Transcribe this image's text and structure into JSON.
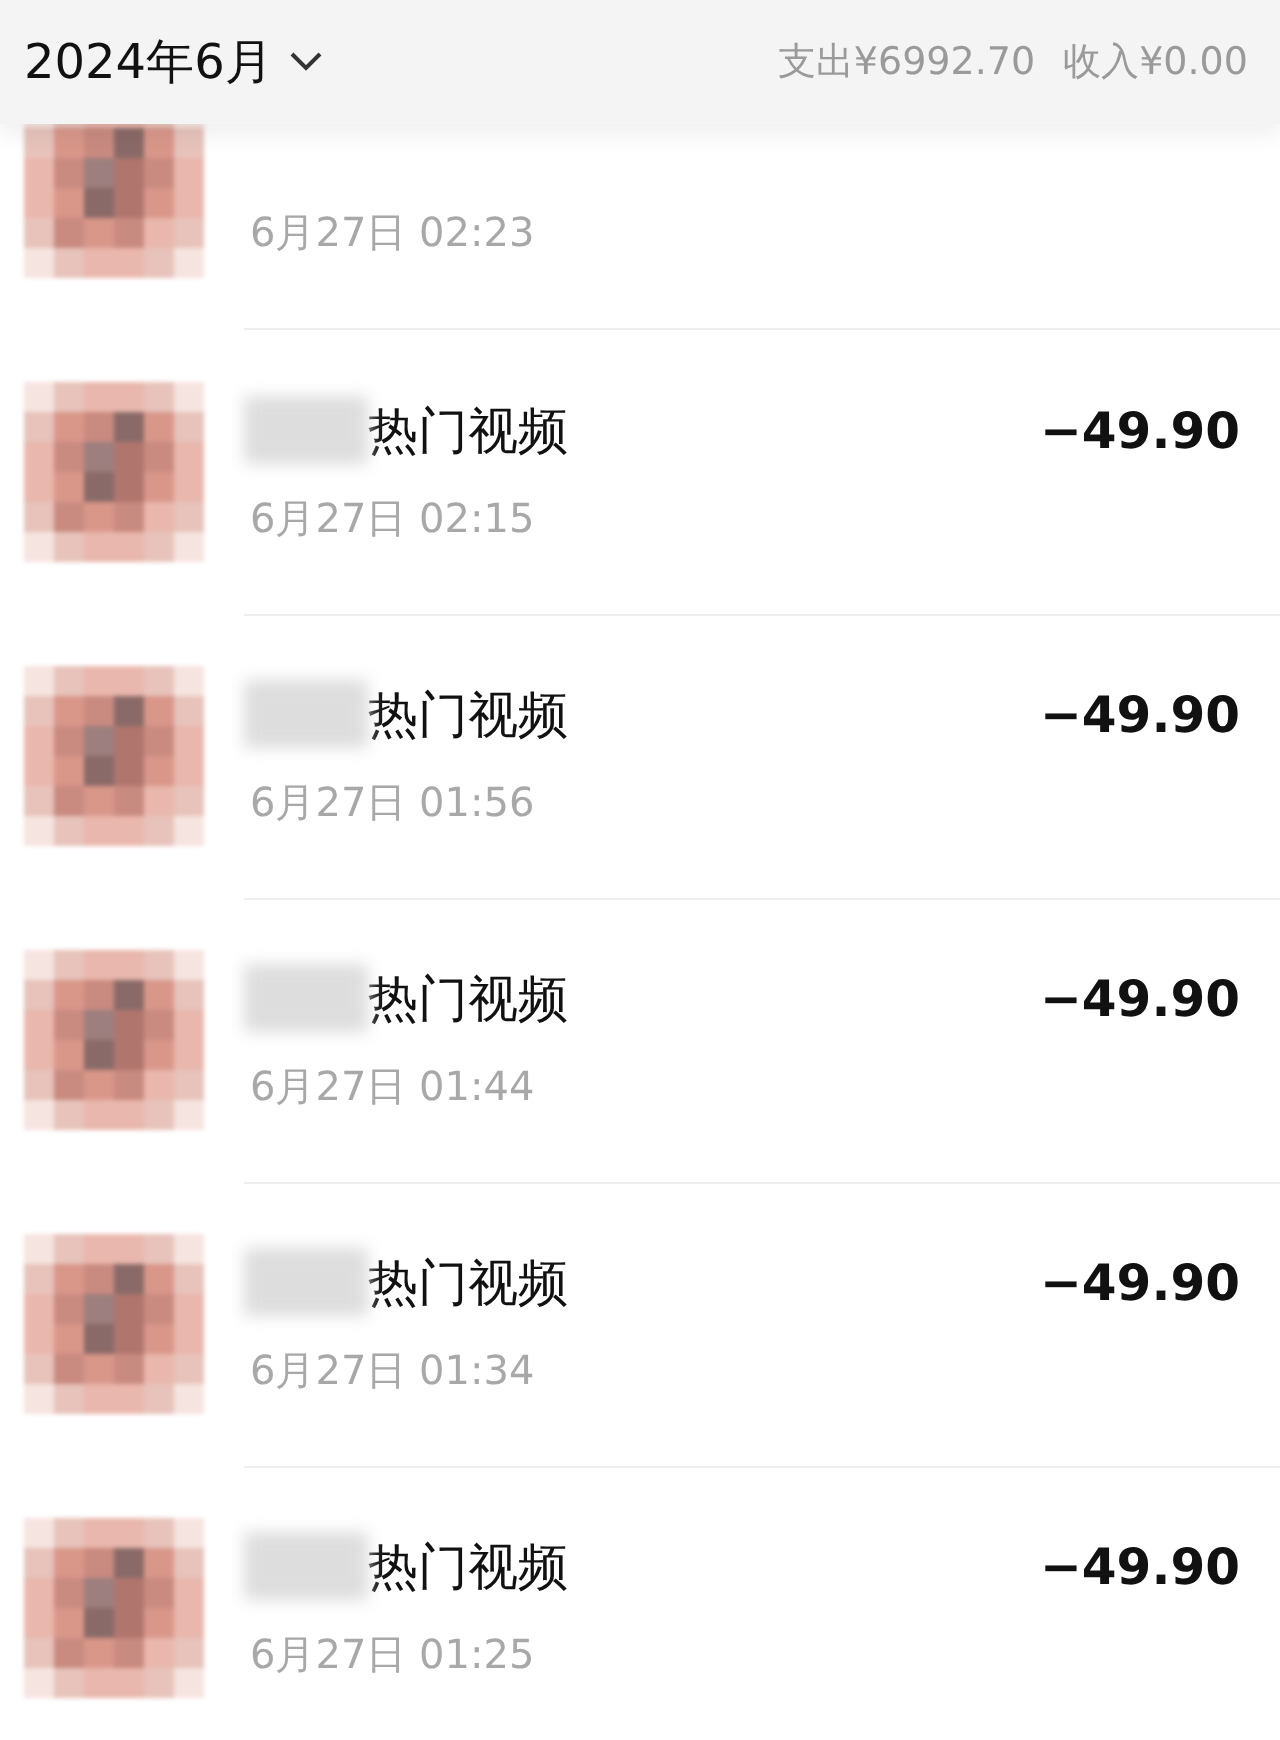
{
  "header": {
    "month": "2024年6月",
    "expense": "支出¥6992.70",
    "income": "收入¥0.00"
  },
  "rows": [
    {
      "date": "6月27日 02:23"
    },
    {
      "title": "热门视频",
      "amount": "−49.90",
      "date": "6月27日 02:15"
    },
    {
      "title": "热门视频",
      "amount": "−49.90",
      "date": "6月27日 01:56"
    },
    {
      "title": "热门视频",
      "amount": "−49.90",
      "date": "6月27日 01:44"
    },
    {
      "title": "热门视频",
      "amount": "−49.90",
      "date": "6月27日 01:34"
    },
    {
      "title": "热门视频",
      "amount": "−49.90",
      "date": "6月27日 01:25"
    }
  ]
}
